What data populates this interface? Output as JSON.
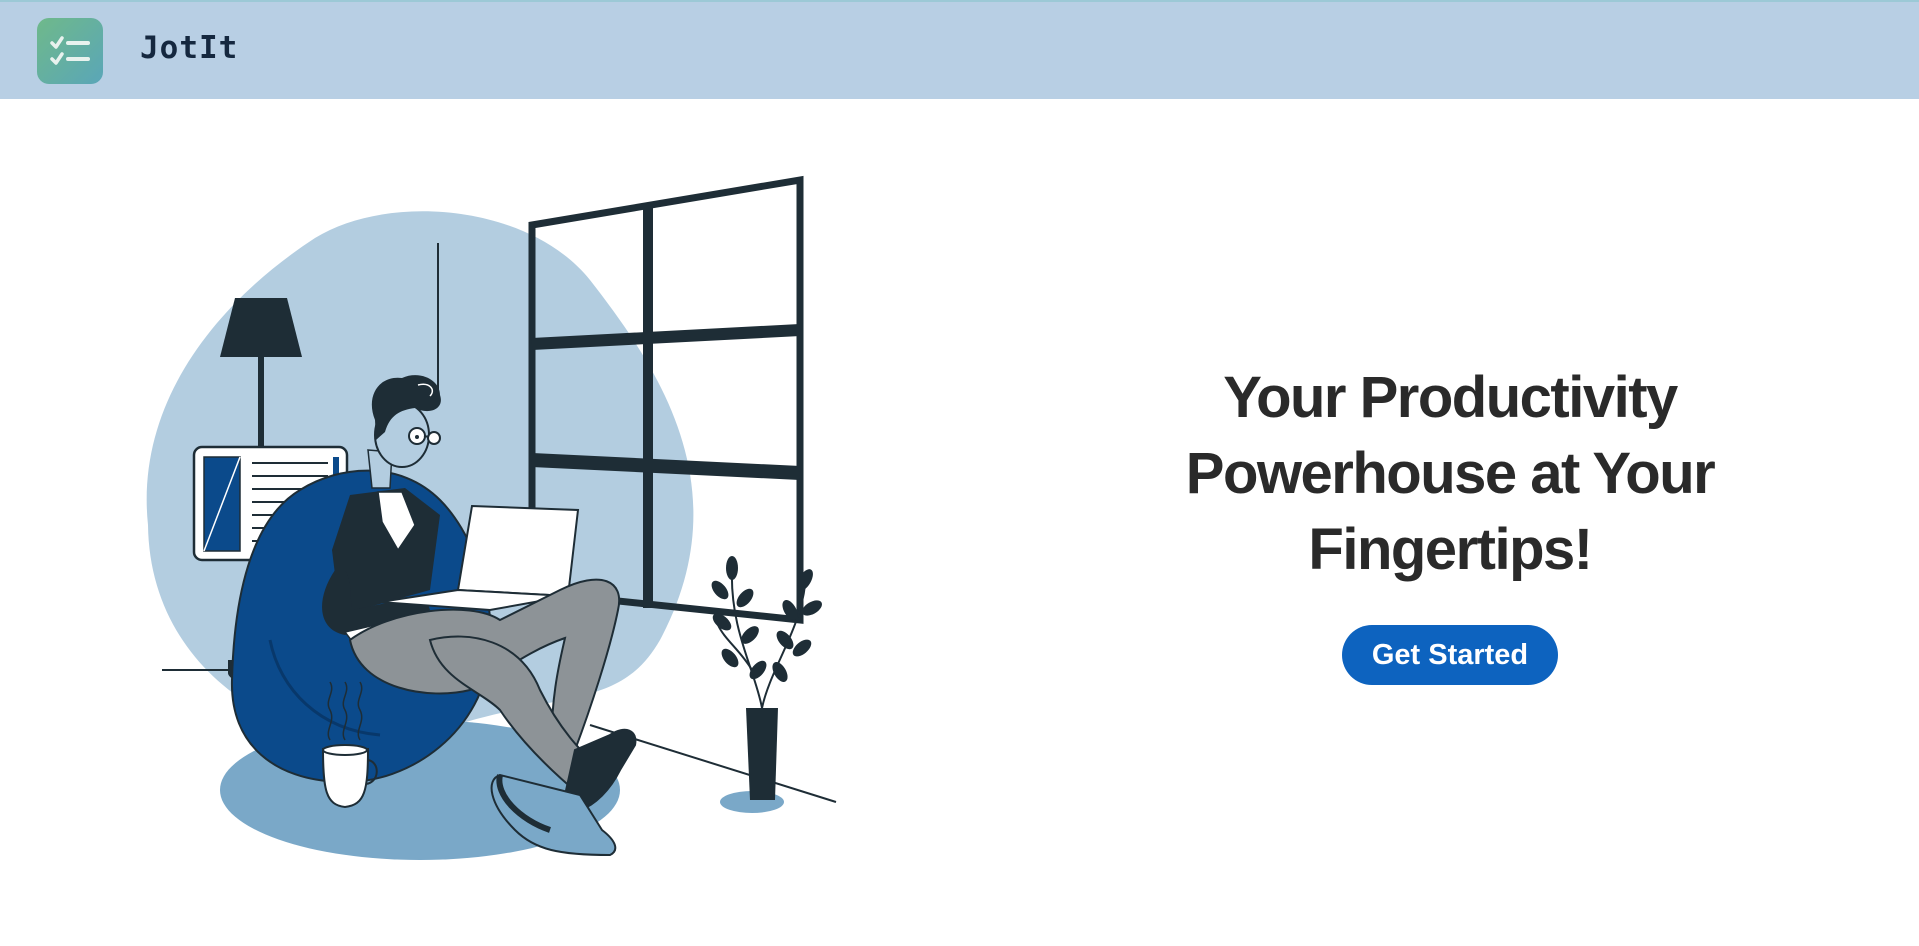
{
  "app": {
    "brand_name": "JotIt",
    "logo_icon": "checklist-icon"
  },
  "hero": {
    "headline": "Your Productivity Powerhouse at Your Fingertips!",
    "cta_label": "Get Started",
    "illustration": "person-on-beanbag-with-laptop-illustration"
  },
  "colors": {
    "navbar_bg": "#b8cfe4",
    "cta_bg": "#0d63bf",
    "headline_text": "#2a2a2a",
    "brand_text": "#15283f",
    "illustration_dark": "#1e2d36",
    "illustration_blue": "#0b4a8b",
    "illustration_light": "#b3cde0"
  }
}
